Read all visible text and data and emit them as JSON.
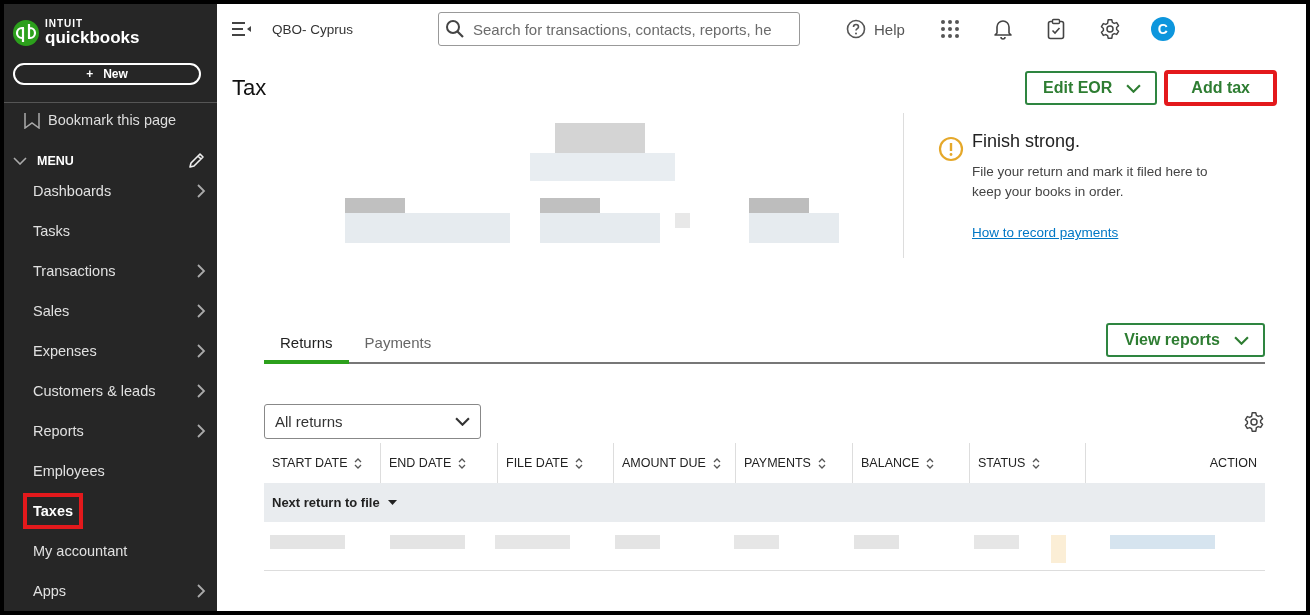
{
  "sidebar": {
    "logo_top": "INTUIT",
    "logo_bottom": "quickbooks",
    "new_icon": "+",
    "new_label": "New",
    "bookmark": "Bookmark this page",
    "menu_label": "MENU",
    "items": [
      {
        "label": "Dashboards",
        "expandable": true,
        "selected": false,
        "highlighted": false
      },
      {
        "label": "Tasks",
        "expandable": false,
        "selected": false,
        "highlighted": false
      },
      {
        "label": "Transactions",
        "expandable": true,
        "selected": false,
        "highlighted": false
      },
      {
        "label": "Sales",
        "expandable": true,
        "selected": false,
        "highlighted": false
      },
      {
        "label": "Expenses",
        "expandable": true,
        "selected": false,
        "highlighted": false
      },
      {
        "label": "Customers & leads",
        "expandable": true,
        "selected": false,
        "highlighted": false
      },
      {
        "label": "Reports",
        "expandable": true,
        "selected": false,
        "highlighted": false
      },
      {
        "label": "Employees",
        "expandable": false,
        "selected": false,
        "highlighted": false
      },
      {
        "label": "Taxes",
        "expandable": false,
        "selected": true,
        "highlighted": true
      },
      {
        "label": "My accountant",
        "expandable": false,
        "selected": false,
        "highlighted": false
      },
      {
        "label": "Apps",
        "expandable": true,
        "selected": false,
        "highlighted": false
      }
    ]
  },
  "topbar": {
    "company": "QBO- Cyprus",
    "search_placeholder": "Search for transactions, contacts, reports, he",
    "help": "Help",
    "avatar": "C"
  },
  "page": {
    "title": "Tax",
    "buttons": [
      {
        "label": "Edit EOR",
        "kind": "dropdown",
        "highlighted": false
      },
      {
        "label": "Add tax",
        "kind": "plain",
        "highlighted": true
      }
    ],
    "notice": {
      "title": "Finish strong.",
      "body": "File your return and mark it filed here to keep your books in order.",
      "link": "How to record payments"
    },
    "tabs": [
      {
        "label": "Returns",
        "selected": true
      },
      {
        "label": "Payments",
        "selected": false
      }
    ],
    "view_reports": "View reports",
    "filter": {
      "value": "All returns"
    },
    "table": {
      "columns": [
        {
          "label": "START DATE",
          "sortable": true
        },
        {
          "label": "END DATE",
          "sortable": true
        },
        {
          "label": "FILE DATE",
          "sortable": true
        },
        {
          "label": "AMOUNT DUE",
          "sortable": true
        },
        {
          "label": "PAYMENTS",
          "sortable": true
        },
        {
          "label": "BALANCE",
          "sortable": true
        },
        {
          "label": "STATUS",
          "sortable": true
        },
        {
          "label": "ACTION",
          "sortable": false
        }
      ],
      "group": "Next return to file"
    }
  }
}
